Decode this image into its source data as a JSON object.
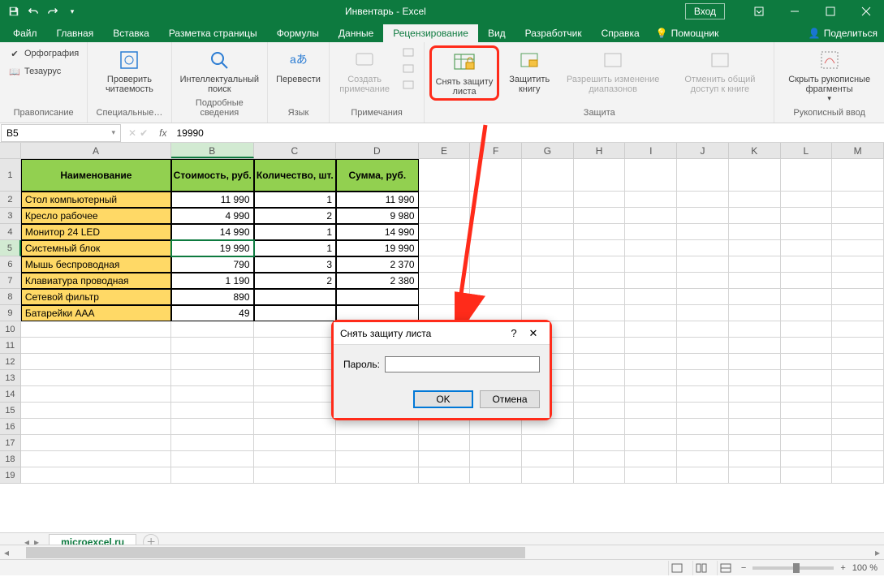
{
  "titlebar": {
    "title": "Инвентарь - Excel",
    "login": "Вход"
  },
  "tabs": {
    "file": "Файл",
    "home": "Главная",
    "insert": "Вставка",
    "layout": "Разметка страницы",
    "formulas": "Формулы",
    "data": "Данные",
    "review": "Рецензирование",
    "view": "Вид",
    "developer": "Разработчик",
    "help": "Справка",
    "tellme": "Помощник",
    "share": "Поделиться"
  },
  "ribbon": {
    "spelling_group": "Правописание",
    "spelling": "Орфография",
    "thesaurus": "Тезаурус",
    "readability": "Проверить читаемость",
    "readability_group": "Специальные…",
    "smart": "Интеллектуальный поиск",
    "smart_group": "Подробные сведения",
    "translate": "Перевести",
    "lang_group": "Язык",
    "newcomment": "Создать примечание",
    "comments_group": "Примечания",
    "unprotect": "Снять защиту листа",
    "protectwb": "Защитить книгу",
    "allowranges": "Разрешить изменение диапазонов",
    "unshare": "Отменить общий доступ к книге",
    "protect_group": "Защита",
    "ink": "Скрыть рукописные фрагменты",
    "ink_group": "Рукописный ввод"
  },
  "formulabar": {
    "namebox": "B5",
    "formula": "19990"
  },
  "cols": [
    "A",
    "B",
    "C",
    "D",
    "E",
    "F",
    "G",
    "H",
    "I",
    "J",
    "K",
    "L",
    "M"
  ],
  "headers": {
    "name": "Наименование",
    "cost": "Стоимость, руб.",
    "qty": "Количество, шт.",
    "sum": "Сумма, руб."
  },
  "rows": [
    {
      "n": "Стол компьютерный",
      "c": "11 990",
      "q": "1",
      "s": "11 990"
    },
    {
      "n": "Кресло рабочее",
      "c": "4 990",
      "q": "2",
      "s": "9 980"
    },
    {
      "n": "Монитор 24 LED",
      "c": "14 990",
      "q": "1",
      "s": "14 990"
    },
    {
      "n": "Системный блок",
      "c": "19 990",
      "q": "1",
      "s": "19 990"
    },
    {
      "n": "Мышь беспроводная",
      "c": "790",
      "q": "3",
      "s": "2 370"
    },
    {
      "n": "Клавиатура проводная",
      "c": "1 190",
      "q": "2",
      "s": "2 380"
    },
    {
      "n": "Сетевой фильтр",
      "c": "890",
      "q": "",
      "s": ""
    },
    {
      "n": "Батарейки AAA",
      "c": "49",
      "q": "",
      "s": ""
    }
  ],
  "sheettab": "microexcel.ru",
  "dialog": {
    "title": "Снять защиту листа",
    "pwd": "Пароль:",
    "ok": "OK",
    "cancel": "Отмена"
  },
  "status": {
    "zoom": "100 %"
  }
}
